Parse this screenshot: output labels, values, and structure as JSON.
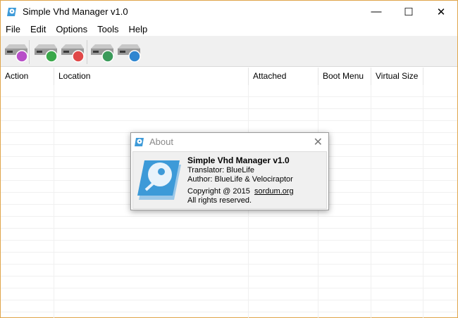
{
  "window": {
    "title": "Simple Vhd Manager v1.0",
    "minimize": "—",
    "maximize": "☐",
    "close": "✕",
    "border_color": "#e0a54a"
  },
  "menu": [
    "File",
    "Edit",
    "Options",
    "Tools",
    "Help"
  ],
  "toolbar": [
    {
      "icon": "drive-check-icon",
      "color": "#b84fc8"
    },
    {
      "icon": "drive-add-icon",
      "color": "#3aa84a"
    },
    {
      "icon": "drive-remove-icon",
      "color": "#e04848"
    },
    {
      "icon": "drive-refresh-icon",
      "color": "#3a9a5a"
    },
    {
      "icon": "drive-settings-icon",
      "color": "#2f86d0"
    }
  ],
  "table": {
    "columns": [
      "Action",
      "Location",
      "Attached",
      "Boot Menu",
      "Virtual Size"
    ],
    "rows": []
  },
  "about": {
    "title": "About",
    "close": "✕",
    "app_name": "Simple Vhd Manager v1.0",
    "translator": "Translator: BlueLife",
    "author": "Author: BlueLife & Velociraptor",
    "copyright": "Copyright @ 2015",
    "link": "sordum.org",
    "rights": "All rights reserved."
  }
}
